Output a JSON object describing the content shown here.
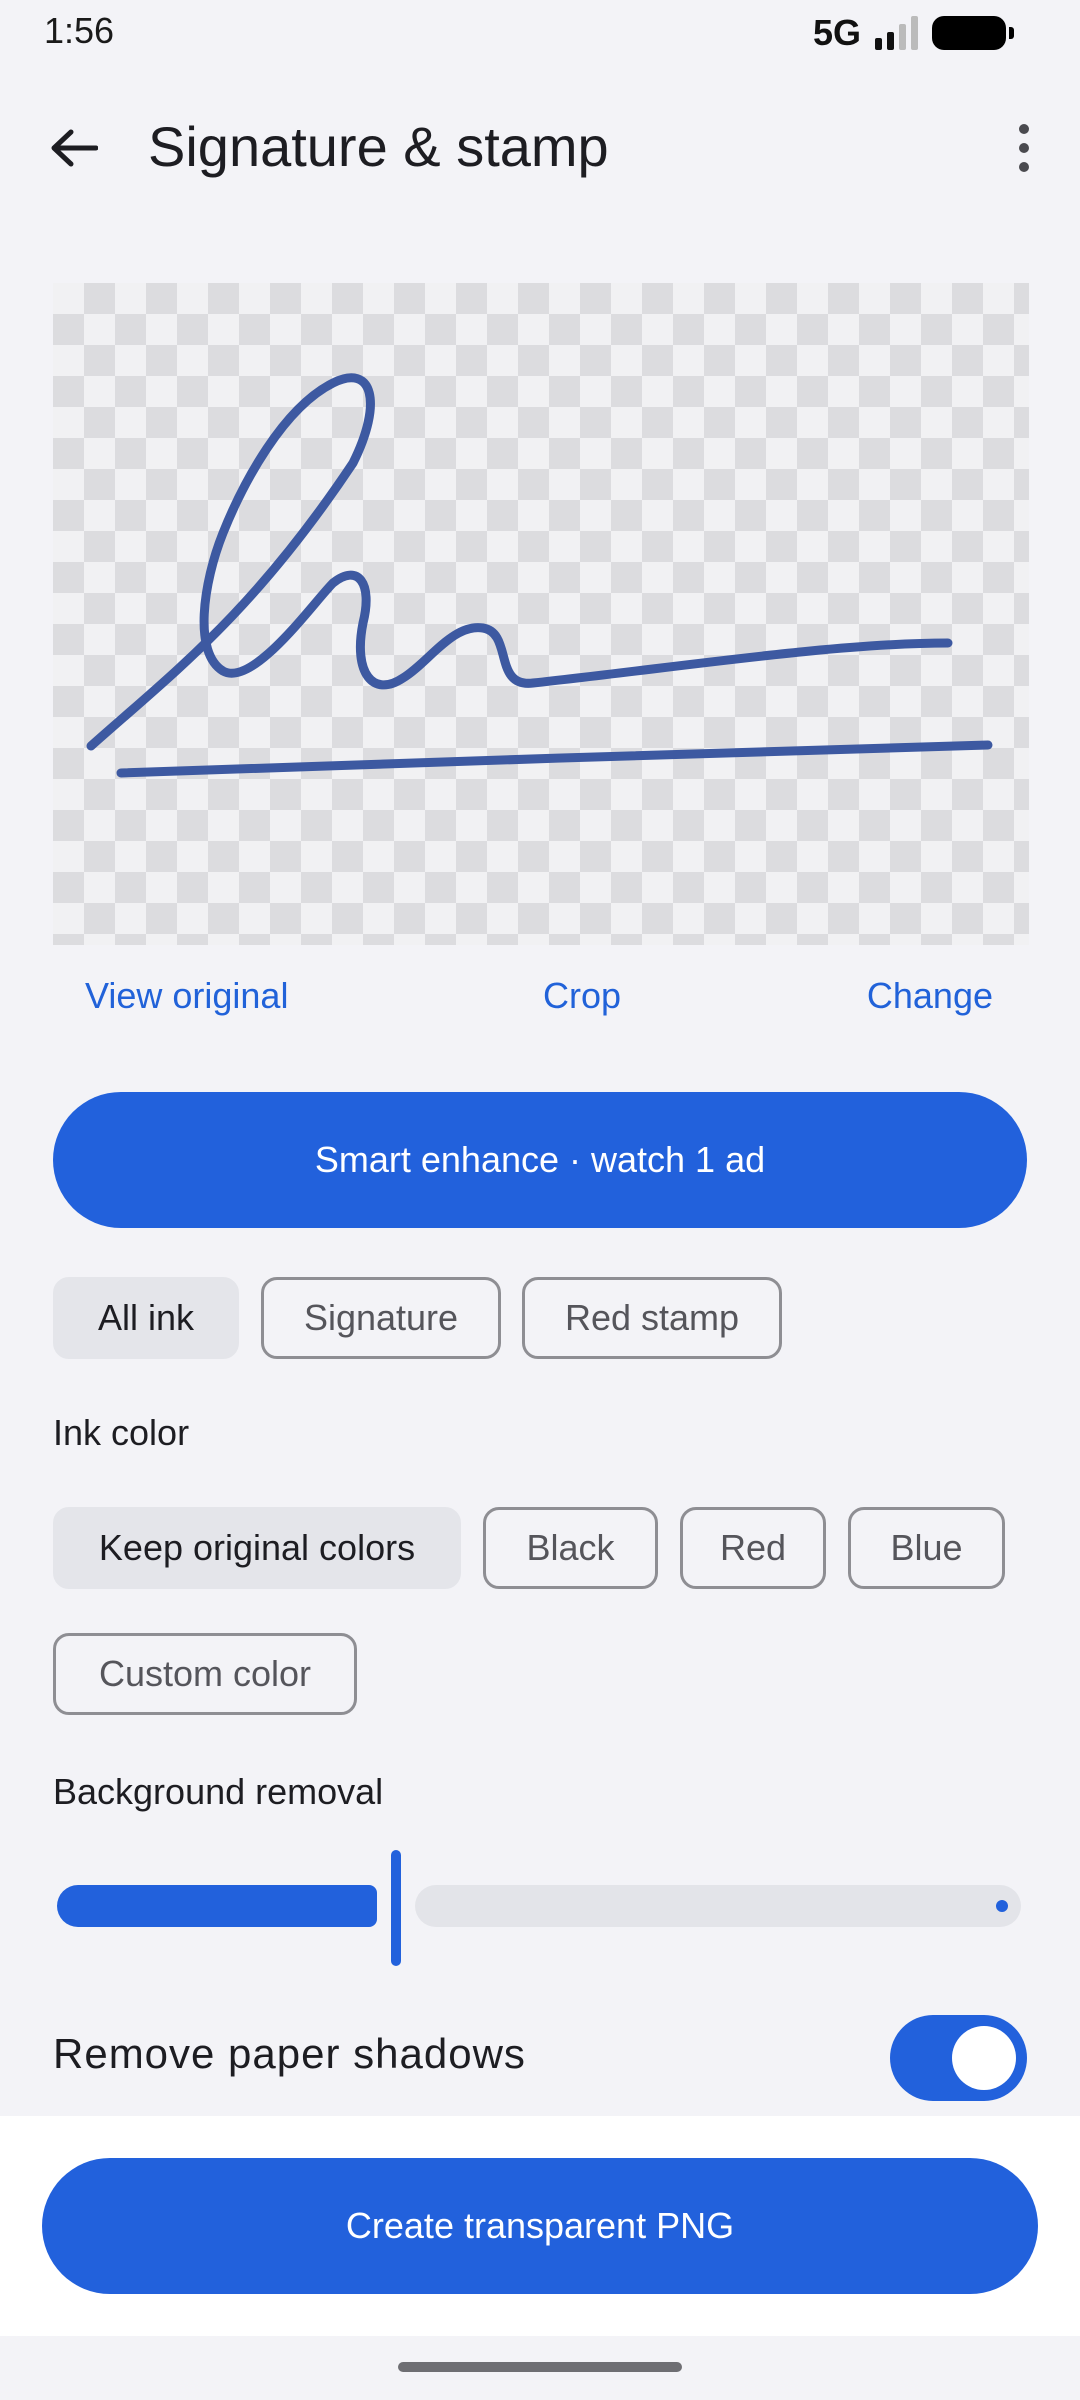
{
  "status_bar": {
    "time": "1:56",
    "network": "5G"
  },
  "header": {
    "title": "Signature & stamp"
  },
  "icons": {
    "back": "arrow-left-icon",
    "more": "more-vertical-icon"
  },
  "preview": {
    "ink_color": "#3d59a1"
  },
  "actions": {
    "view_original": "View original",
    "crop": "Crop",
    "change": "Change"
  },
  "enhance_button": {
    "label": "Smart enhance · watch 1 ad"
  },
  "filters": {
    "items": [
      {
        "label": "All ink",
        "selected": true
      },
      {
        "label": "Signature",
        "selected": false
      },
      {
        "label": "Red stamp",
        "selected": false
      }
    ]
  },
  "ink_color": {
    "heading": "Ink color",
    "options": [
      {
        "label": "Keep original colors",
        "selected": true
      },
      {
        "label": "Black",
        "selected": false
      },
      {
        "label": "Red",
        "selected": false
      },
      {
        "label": "Blue",
        "selected": false
      },
      {
        "label": "Custom color",
        "selected": false
      }
    ]
  },
  "background_removal": {
    "heading": "Background removal",
    "level": 0.35
  },
  "paper_shadows": {
    "label": "Remove paper shadows",
    "enabled": true
  },
  "create_button": {
    "label": "Create transparent PNG"
  },
  "colors": {
    "accent": "#2261dc",
    "link": "#2162d9",
    "background": "#f3f3f7"
  }
}
